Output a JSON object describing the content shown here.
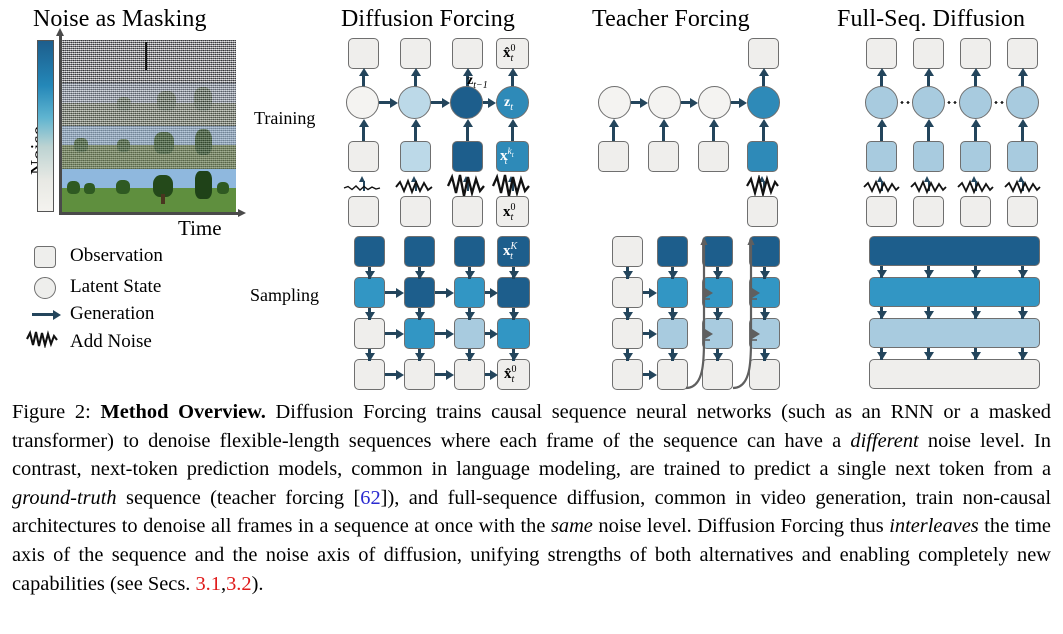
{
  "figure": {
    "left_panel": {
      "title": "Noise as Masking",
      "y_axis_label": "Noise",
      "x_axis_label": "Time",
      "colorbar": {
        "high": "#1d5e8c",
        "mid": "#2487b8",
        "low": "#f4f3ef",
        "meaning": "noise level from high (top, dark blue) to low (bottom, white)"
      },
      "grid": {
        "rows": 4,
        "cols": 4,
        "noise_levels_top_to_bottom": [
          1.0,
          0.66,
          0.33,
          0.0
        ],
        "description": "Minecraft-style video frames, each row progressively less noisy; bottom row is clean."
      }
    },
    "row_labels": [
      "Training",
      "Sampling"
    ],
    "columns": [
      {
        "id": "diffusion-forcing",
        "title": "Diffusion Forcing"
      },
      {
        "id": "teacher-forcing",
        "title": "Teacher Forcing"
      },
      {
        "id": "full-seq-diffusion",
        "title": "Full-Seq. Diffusion"
      }
    ],
    "legend": [
      {
        "icon": "square",
        "label": "Observation"
      },
      {
        "icon": "circle",
        "label": "Latent State"
      },
      {
        "icon": "arrow",
        "label": "Generation"
      },
      {
        "icon": "squiggle",
        "label": "Add Noise"
      }
    ],
    "math_labels": {
      "x_hat_0": "x̂⁰ₜ",
      "z_t_minus_1": "z_{t-1}",
      "z_t": "z_t",
      "x_kt": "x^{k_t}_t",
      "x_0": "x⁰ₜ",
      "x_K": "x^K_t"
    },
    "palette": {
      "noise_dark": "#1d5e8c",
      "noise_mid": "#2e8ab8",
      "noise_light": "#a8cbdf",
      "noise_none": "#efeeec",
      "arrow": "#23455c",
      "outline": "#6f6f6f"
    },
    "diffusion_forcing": {
      "training": {
        "top_obs_row": [
          "none",
          "none",
          "none",
          "none"
        ],
        "latents": [
          "none",
          "light",
          "dark",
          "mid"
        ],
        "noisy_inputs": [
          "none",
          "light",
          "dark",
          "mid"
        ],
        "noise_amount": [
          "tiny",
          "small",
          "large",
          "large"
        ],
        "bottom_obs_row": [
          "none",
          "none",
          "none",
          "none"
        ]
      },
      "sampling": {
        "rows": [
          [
            "dark",
            "dark",
            "dark",
            "dark"
          ],
          [
            "mid",
            "dark",
            "mid",
            "dark"
          ],
          [
            "none",
            "mid",
            "light",
            "mid"
          ],
          [
            "none",
            "none",
            "none",
            "none"
          ]
        ]
      }
    },
    "teacher_forcing": {
      "training": {
        "latents": [
          "none",
          "none",
          "none",
          "mid"
        ],
        "inputs": [
          "none",
          "none",
          "none",
          "mid"
        ],
        "output_obs": "none",
        "noised_source": "none"
      },
      "sampling": {
        "rows": [
          [
            "none",
            "dark",
            "dark",
            "dark"
          ],
          [
            "none",
            "mid",
            "mid",
            "mid"
          ],
          [
            "none",
            "light",
            "light",
            "light"
          ],
          [
            "none",
            "none",
            "none",
            "none"
          ]
        ]
      }
    },
    "full_seq_diffusion": {
      "training": {
        "top_obs_row": [
          "none",
          "none",
          "none",
          "none"
        ],
        "latents": [
          "light",
          "light",
          "light",
          "light"
        ],
        "noisy_inputs": [
          "light",
          "light",
          "light",
          "light"
        ],
        "bottom_obs_row": [
          "none",
          "none",
          "none",
          "none"
        ],
        "connector": "dotted"
      },
      "sampling": {
        "bars": [
          "dark",
          "mid",
          "light",
          "none"
        ]
      }
    }
  },
  "caption": {
    "label": "Figure 2:",
    "bold_lead": "Method Overview.",
    "text_1": " Diffusion Forcing trains causal sequence neural networks (such as an RNN or a masked transformer) to denoise flexible-length sequences where each frame of the sequence can have a ",
    "italic_1": "different",
    "text_2": " noise level. In contrast, next-token prediction models, common in language modeling, are trained to predict a single next token from a ",
    "italic_2": "ground-truth",
    "text_3": " sequence (teacher forcing [",
    "cite_1": "62",
    "text_4": "]), and full-sequence diffusion, common in video generation, train non-causal architectures to denoise all frames in a sequence at once with the ",
    "italic_3": "same",
    "text_5": " noise level. Diffusion Forcing thus ",
    "italic_4": "interleaves",
    "text_6": " the time axis of the sequence and the noise axis of diffusion, unifying strengths of both alternatives and enabling completely new capabilities (see Secs. ",
    "secref_1": "3.1",
    "text_7": ",",
    "secref_2": "3.2",
    "text_8": ")."
  }
}
